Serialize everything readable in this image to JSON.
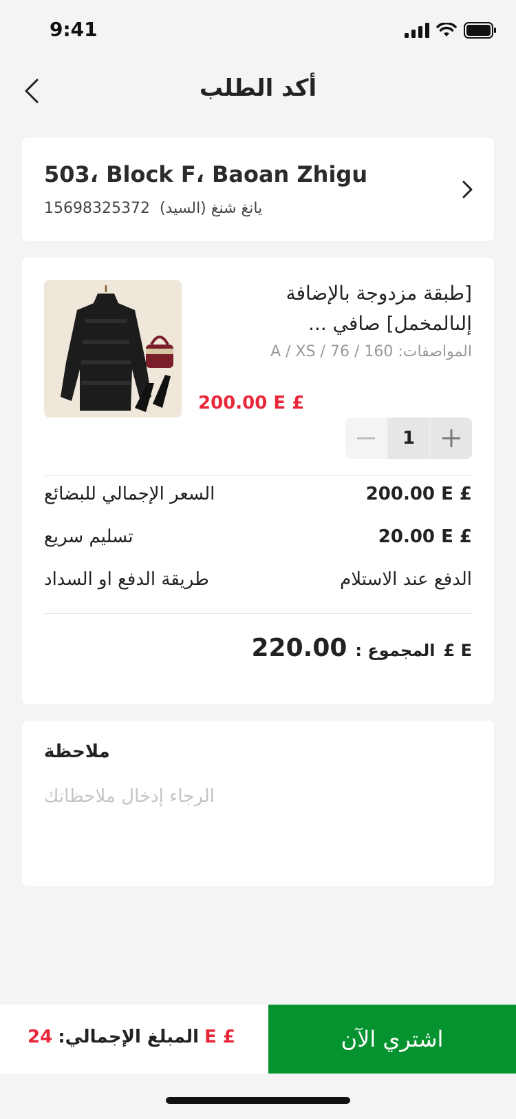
{
  "status_bar": {
    "time": "9:41"
  },
  "nav": {
    "title": "أكد الطلب"
  },
  "address": {
    "line1": "503، Block F، Baoan Zhigu",
    "phone": "15698325372",
    "recipient": "يانغ شنغ (السيد)"
  },
  "product": {
    "name": "[طبقة مزدوجة بالإضافة إلىالمخمل] صافي ...",
    "spec": "المواصفات: A / XS / 76 / 160",
    "price": "200.00",
    "currency": "E £",
    "quantity": "1"
  },
  "summary": {
    "goods_total_label": "السعر الإجمالي للبضائع",
    "goods_total_value": "200.00",
    "delivery_label": "تسليم سريع",
    "delivery_value": "20.00",
    "payment_label": "طريقة الدفع او السداد",
    "payment_value": "الدفع عند الاستلام",
    "currency": "E £",
    "total_label": "المجموع :",
    "total_value": "220.00"
  },
  "note": {
    "title": "ملاحظة",
    "placeholder": "الرجاء إدخال ملاحظاتك"
  },
  "bottom": {
    "total_label": "المبلغ الإجمالي:",
    "currency": "E £",
    "amount": "24",
    "buy_label": "اشتري الآن"
  },
  "colors": {
    "accent_green": "#05932f",
    "price_red": "#e8283a",
    "background": "#f4f4f4"
  },
  "icons": [
    "signal-icon",
    "wifi-icon",
    "battery-icon",
    "back-arrow-icon",
    "chevron-right-icon",
    "minus-icon",
    "plus-icon"
  ]
}
